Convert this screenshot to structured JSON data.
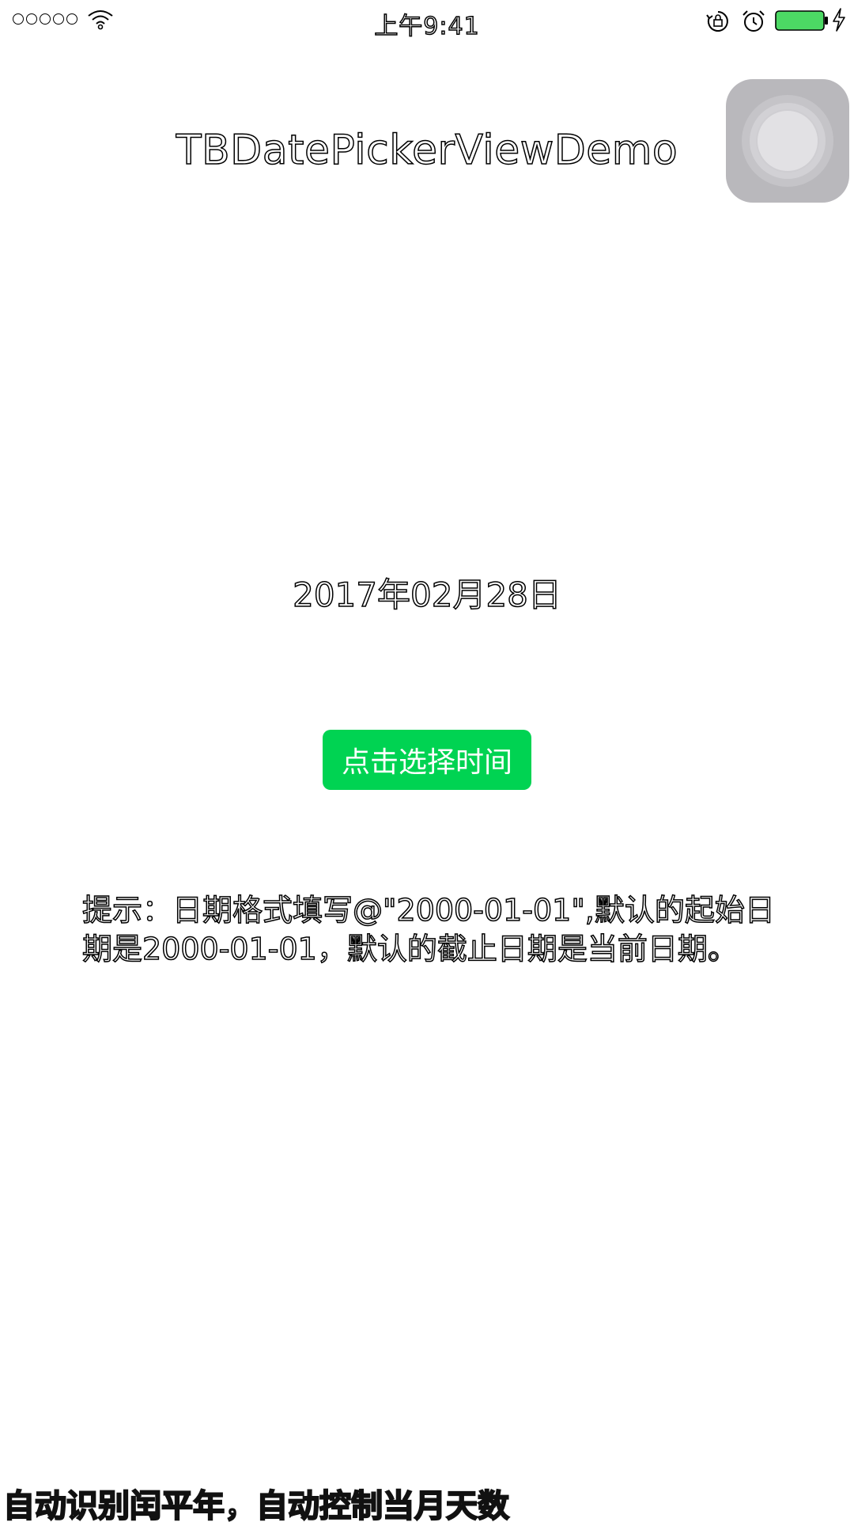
{
  "status_bar": {
    "time": "上午9:41",
    "icons": [
      "signal-dots-icon",
      "wifi-icon",
      "rotation-lock-icon",
      "alarm-icon",
      "battery-icon",
      "charging-icon"
    ],
    "battery_color": "#4cd964"
  },
  "nav": {
    "title": "TBDatePickerViewDemo"
  },
  "main": {
    "date_label": "2017年02月28日",
    "pick_button_label": "点击选择时间",
    "hint": "提示：日期格式填写@\"2000-01-01\",默认的起始日期是2000-01-01，默认的截止日期是当前日期。"
  },
  "overlay": {
    "caption": "自动识别闰平年，自动控制当月天数"
  },
  "colors": {
    "button_green": "#00d352",
    "assistive_touch_gray": "#b9b8bc"
  }
}
